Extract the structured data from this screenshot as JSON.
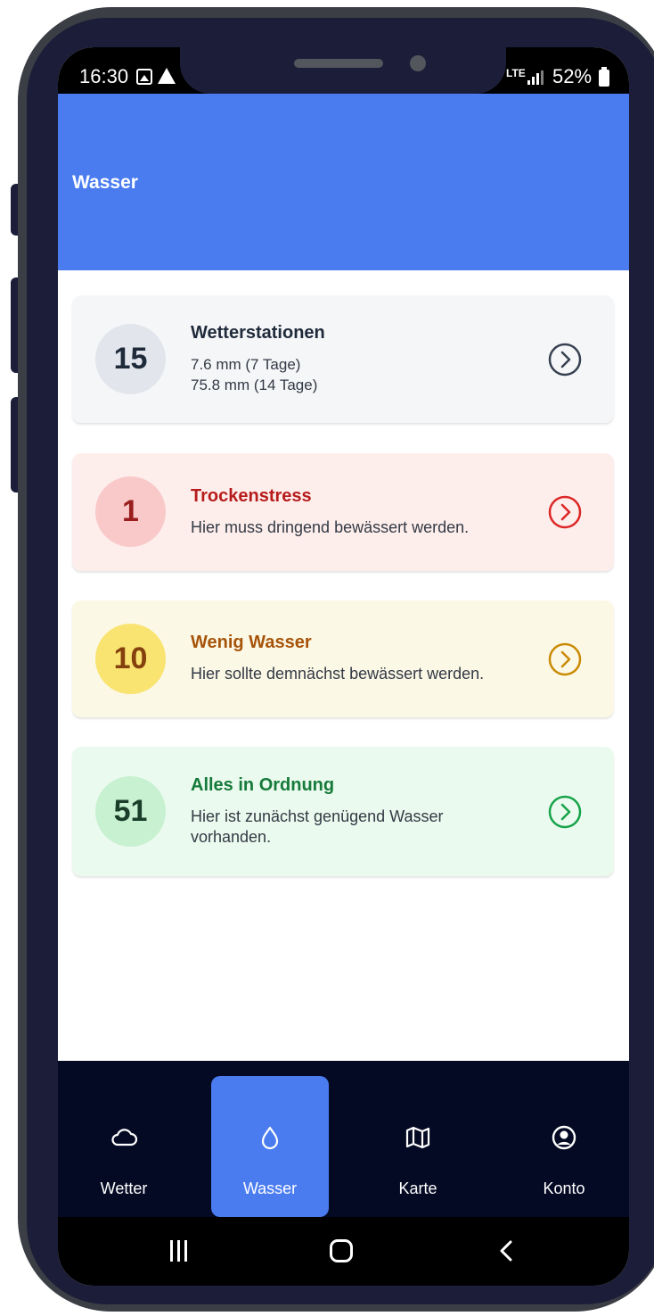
{
  "status_bar": {
    "time": "16:30",
    "network": "LTE",
    "battery": "52%"
  },
  "header": {
    "title": "Wasser"
  },
  "cards": [
    {
      "count": "15",
      "title": "Wetterstationen",
      "lines": [
        "7.6 mm (7 Tage)",
        "75.8 mm (14 Tage)"
      ],
      "color": "#374151"
    },
    {
      "count": "1",
      "title": "Trockenstress",
      "lines": [
        "Hier muss dringend bewässert werden."
      ],
      "color": "#dc2626"
    },
    {
      "count": "10",
      "title": "Wenig Wasser",
      "lines": [
        "Hier sollte demnächst bewässert werden."
      ],
      "color": "#ca8a04"
    },
    {
      "count": "51",
      "title": "Alles in Ordnung",
      "lines": [
        "Hier ist zunächst genügend Wasser vorhanden."
      ],
      "color": "#16a34a"
    }
  ],
  "bottom_nav": {
    "items": [
      {
        "label": "Wetter",
        "icon": "cloud-icon",
        "active": false
      },
      {
        "label": "Wasser",
        "icon": "droplet-icon",
        "active": true
      },
      {
        "label": "Karte",
        "icon": "map-icon",
        "active": false
      },
      {
        "label": "Konto",
        "icon": "user-circle-icon",
        "active": false
      }
    ]
  },
  "colors": {
    "primary": "#4a7cf0",
    "nav_background": "#050a24"
  }
}
